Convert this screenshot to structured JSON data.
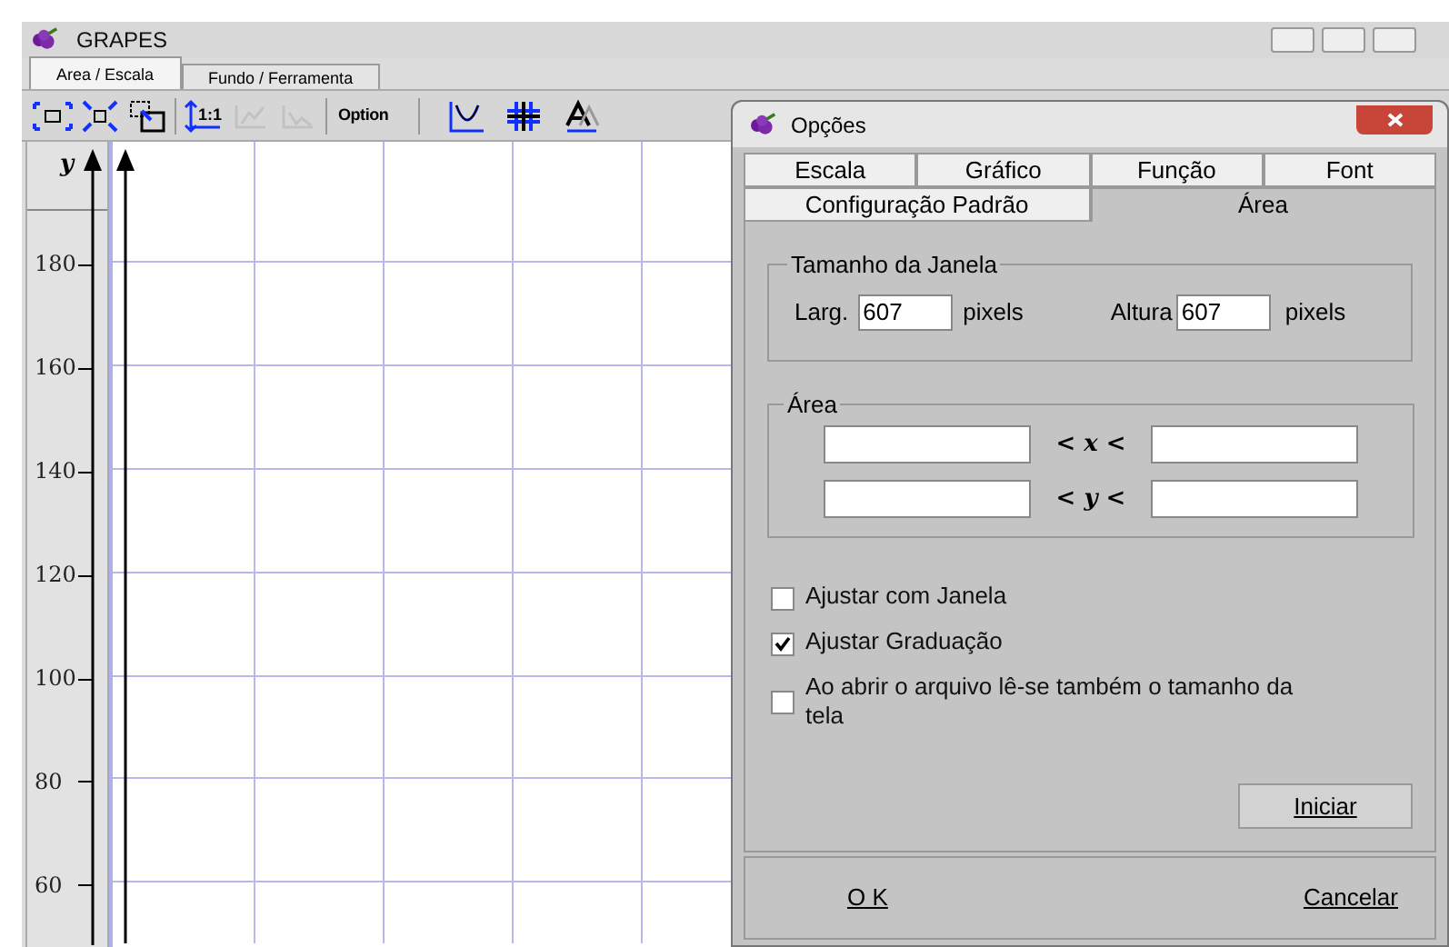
{
  "window": {
    "title": "GRAPES"
  },
  "tabs": [
    {
      "label": "Area / Escala",
      "selected": true
    },
    {
      "label": "Fundo / Ferramenta",
      "selected": false
    }
  ],
  "toolbar": {
    "buttons": [
      {
        "disabled": false
      },
      {
        "disabled": false
      },
      {
        "disabled": false
      },
      {
        "disabled": false,
        "label": "1:1"
      },
      {
        "disabled": true
      },
      {
        "disabled": true
      }
    ],
    "option_label": "Option",
    "tools": [
      {
        "disabled": false
      },
      {
        "disabled": false
      },
      {
        "disabled": false
      }
    ]
  },
  "y_ruler": {
    "label": "y",
    "ticks": [
      "180",
      "160",
      "140",
      "120",
      "100",
      "80",
      "60"
    ]
  },
  "dialog": {
    "title": "Opções",
    "tab_rows": [
      [
        {
          "label": "Escala",
          "selected": false
        },
        {
          "label": "Gráfico",
          "selected": false
        },
        {
          "label": "Função",
          "selected": false
        },
        {
          "label": "Font",
          "selected": false
        }
      ],
      [
        {
          "label": "Configuração Padrão",
          "selected": false
        },
        {
          "label": "Área",
          "selected": true
        }
      ]
    ],
    "window_size": {
      "title": "Tamanho da Janela",
      "width_label": "Larg.",
      "width_value": "607",
      "width_unit": "pixels",
      "height_label": "Altura",
      "height_value": "607",
      "height_unit": "pixels"
    },
    "area": {
      "title": "Área",
      "x_label": "< x <",
      "y_label": "< y <"
    },
    "checkboxes": [
      {
        "label": "Ajustar com Janela",
        "checked": false
      },
      {
        "label": "Ajustar Graduação",
        "checked": true
      },
      {
        "label": "Ao abrir o arquivo lê-se também o tamanho da tela",
        "checked": false
      }
    ],
    "start_button": "Iniciar",
    "ok_button": "O K",
    "cancel_button": "Cancelar"
  }
}
